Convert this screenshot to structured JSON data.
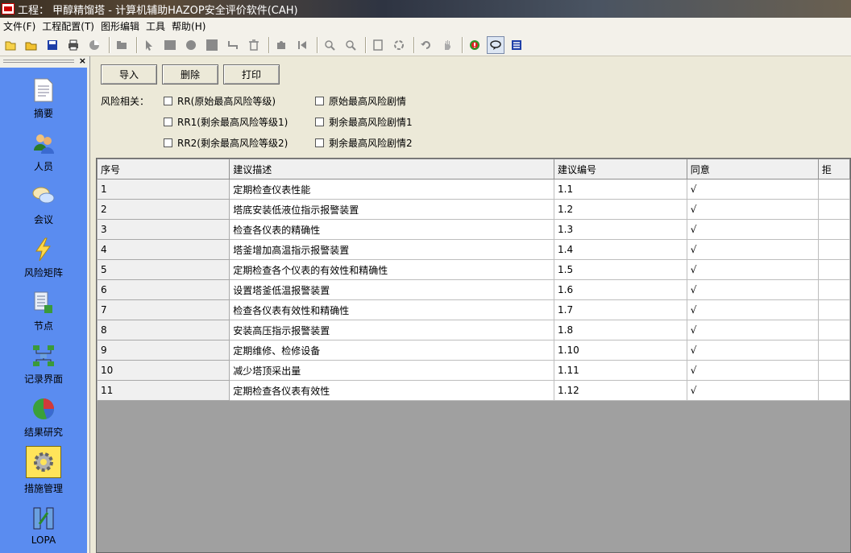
{
  "window": {
    "title": "工程： 甲醇精馏塔 - 计算机辅助HAZOP安全评价软件(CAH)"
  },
  "menu": [
    "文件(F)",
    "工程配置(T)",
    "图形编辑",
    "工具",
    "帮助(H)"
  ],
  "toolbar_icons": [
    "new-icon",
    "open-icon",
    "save-icon",
    "print-icon",
    "pie-icon",
    "folder-icon",
    "pointer-icon",
    "rect-icon",
    "circle-icon",
    "square-icon",
    "connector-icon",
    "delete-icon",
    "puzzle-icon",
    "first-icon",
    "zoom-in-icon",
    "zoom-out-icon",
    "fit-page-icon",
    "refresh-icon",
    "undo-icon",
    "hand-icon",
    "alert-icon",
    "comment-icon",
    "list-icon"
  ],
  "sidebar": {
    "items": [
      {
        "label": "摘要",
        "icon": "document-icon"
      },
      {
        "label": "人员",
        "icon": "people-icon"
      },
      {
        "label": "会议",
        "icon": "chat-icon"
      },
      {
        "label": "风险矩阵",
        "icon": "lightning-icon"
      },
      {
        "label": "节点",
        "icon": "node-list-icon"
      },
      {
        "label": "记录界面",
        "icon": "flowchart-icon"
      },
      {
        "label": "结果研究",
        "icon": "pie-chart-icon"
      },
      {
        "label": "措施管理",
        "icon": "gear-icon"
      },
      {
        "label": "LOPA",
        "icon": "lopa-icon"
      }
    ],
    "selected": "措施管理"
  },
  "actions": {
    "import": "导入",
    "delete": "删除",
    "print": "打印"
  },
  "risk": {
    "label": "风险相关：",
    "options": [
      {
        "label": "RR(原始最高风险等级)",
        "checked": false
      },
      {
        "label": "原始最高风险剧情",
        "checked": false
      },
      {
        "label": "RR1(剩余最高风险等级1)",
        "checked": false
      },
      {
        "label": "剩余最高风险剧情1",
        "checked": false
      },
      {
        "label": "RR2(剩余最高风险等级2)",
        "checked": false
      },
      {
        "label": "剩余最高风险剧情2",
        "checked": false
      }
    ]
  },
  "table": {
    "headers": [
      "序号",
      "建议描述",
      "建议编号",
      "同意",
      "拒"
    ],
    "rows": [
      [
        "1",
        "定期检查仪表性能",
        "1.1",
        "√"
      ],
      [
        "2",
        "塔底安装低液位指示报警装置",
        "1.2",
        "√"
      ],
      [
        "3",
        "检查各仪表的精确性",
        "1.3",
        "√"
      ],
      [
        "4",
        "塔釜增加高温指示报警装置",
        "1.4",
        "√"
      ],
      [
        "5",
        "定期检查各个仪表的有效性和精确性",
        "1.5",
        "√"
      ],
      [
        "6",
        "设置塔釜低温报警装置",
        "1.6",
        "√"
      ],
      [
        "7",
        "检查各仪表有效性和精确性",
        "1.7",
        "√"
      ],
      [
        "8",
        "安装高压指示报警装置",
        "1.8",
        "√"
      ],
      [
        "9",
        "定期维修、检修设备",
        "1.10",
        "√"
      ],
      [
        "10",
        "减少塔顶采出量",
        "1.11",
        "√"
      ],
      [
        "11",
        "定期检查各仪表有效性",
        "1.12",
        "√"
      ]
    ]
  }
}
